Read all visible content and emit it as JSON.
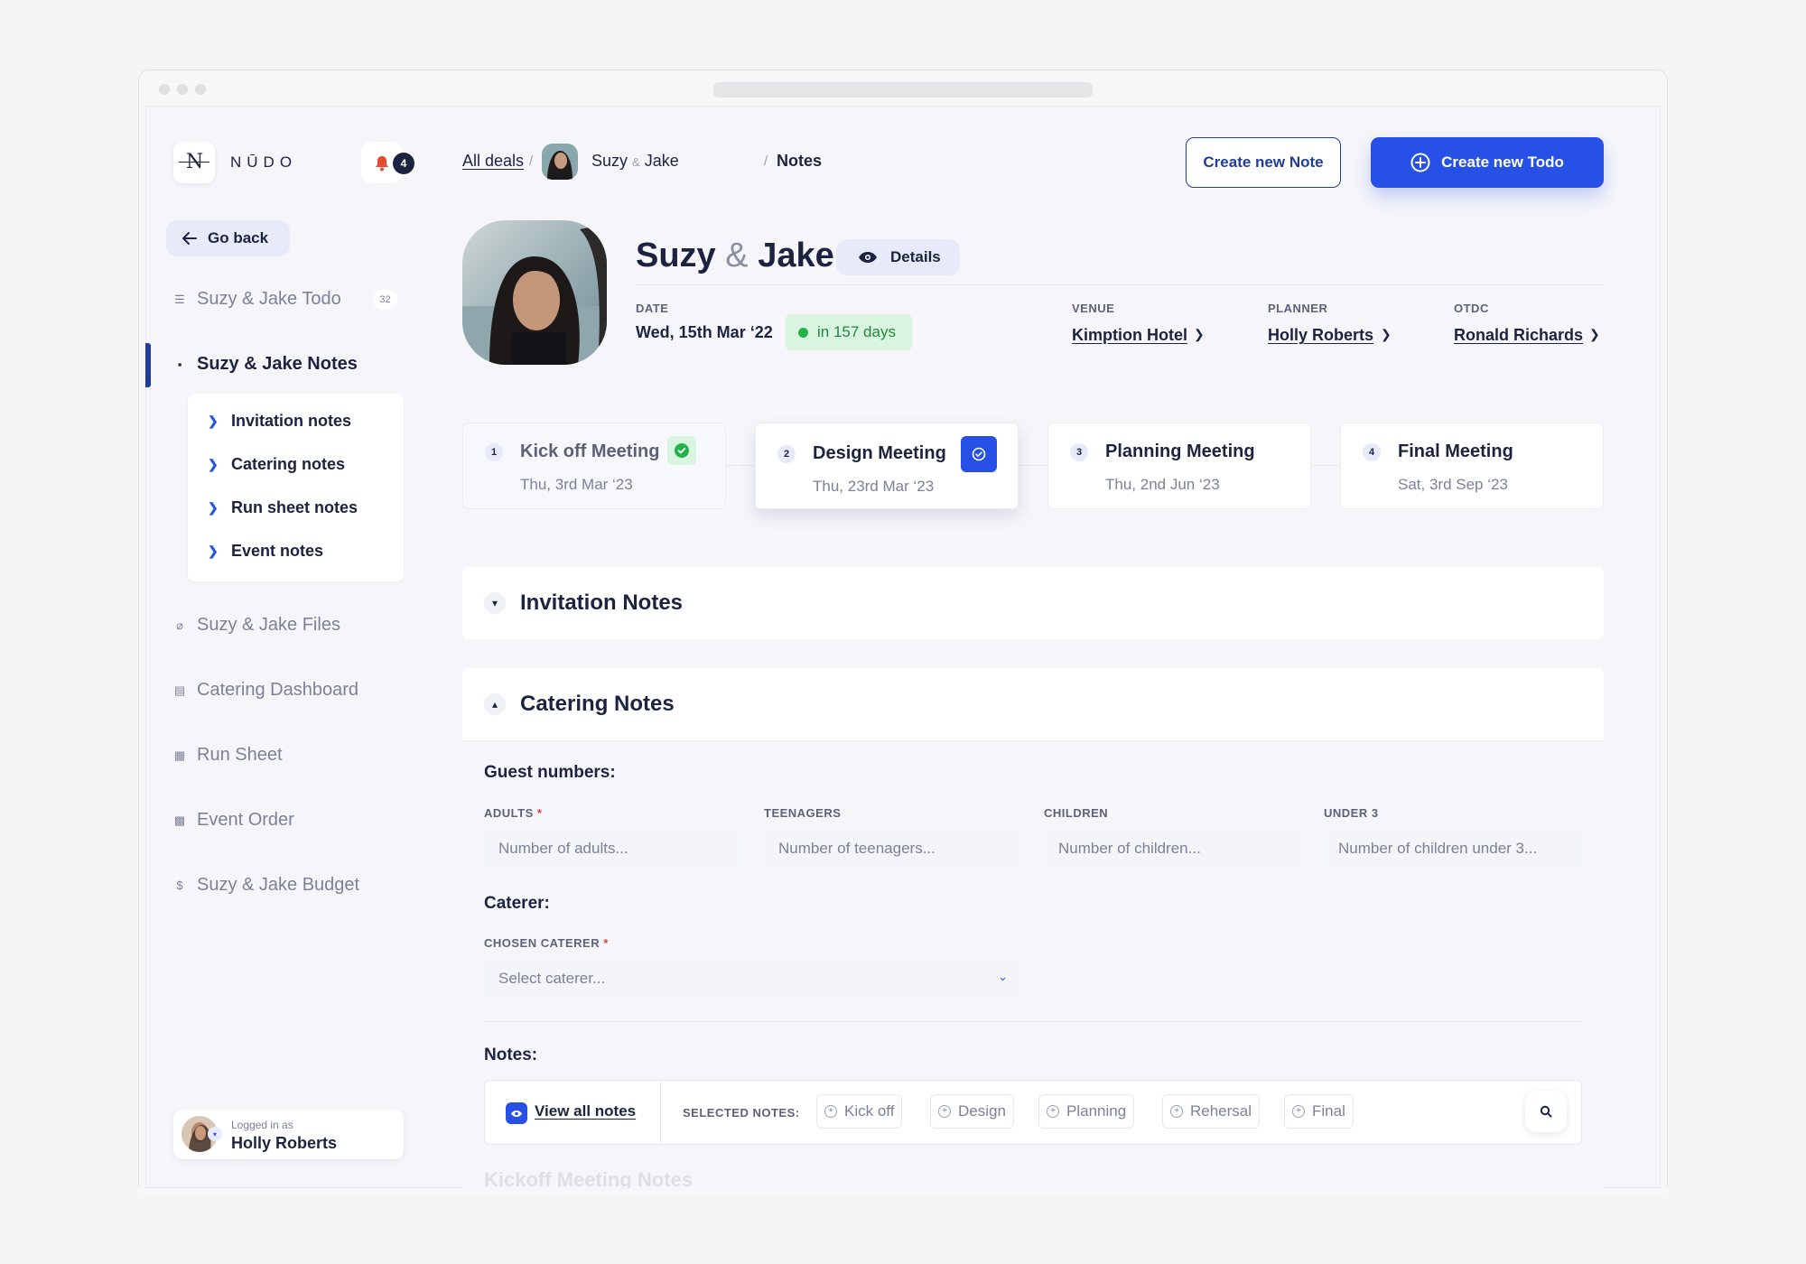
{
  "brand": {
    "logo_letter": "N",
    "name": "NŪDO"
  },
  "notifications": {
    "count": "4"
  },
  "sidebar": {
    "go_back": "Go back",
    "items": [
      {
        "label": "Suzy & Jake Todo",
        "count": "32"
      },
      {
        "label": "Suzy & Jake Notes"
      },
      {
        "label": "Suzy & Jake Files"
      },
      {
        "label": "Catering Dashboard"
      },
      {
        "label": "Run Sheet"
      },
      {
        "label": "Event Order"
      },
      {
        "label": "Suzy & Jake Budget"
      }
    ],
    "subitems": [
      "Invitation notes",
      "Catering notes",
      "Run sheet notes",
      "Event notes"
    ]
  },
  "user": {
    "logged_in_as": "Logged in as",
    "name": "Holly Roberts"
  },
  "breadcrumb": {
    "all_deals": "All deals",
    "sep": "/",
    "name_a": "Suzy",
    "amp": "&",
    "name_b": "Jake",
    "current": "Notes"
  },
  "header": {
    "create_note": "Create new Note",
    "create_todo": "Create new Todo"
  },
  "deal": {
    "name_a": "Suzy",
    "amp": "&",
    "name_b": "Jake",
    "details_label": "Details",
    "date_label": "DATE",
    "date": "Wed, 15th Mar ‘22",
    "countdown": "in 157 days",
    "venue_label": "VENUE",
    "venue": "Kimption Hotel",
    "planner_label": "PLANNER",
    "planner": "Holly Roberts",
    "otdc_label": "OTDC",
    "otdc": "Ronald Richards"
  },
  "meetings": [
    {
      "num": "1",
      "name": "Kick off Meeting",
      "date": "Thu, 3rd Mar ‘23",
      "status": "done"
    },
    {
      "num": "2",
      "name": "Design Meeting",
      "date": "Thu, 23rd Mar ‘23",
      "status": "current"
    },
    {
      "num": "3",
      "name": "Planning Meeting",
      "date": "Thu, 2nd Jun ‘23",
      "status": "upcoming"
    },
    {
      "num": "4",
      "name": "Final Meeting",
      "date": "Sat, 3rd Sep ‘23",
      "status": "upcoming"
    }
  ],
  "invitation": {
    "title": "Invitation Notes"
  },
  "catering": {
    "title": "Catering Notes",
    "guest_heading": "Guest numbers:",
    "fields": [
      {
        "label": "ADULTS",
        "required": "*",
        "placeholder": "Number of adults..."
      },
      {
        "label": "TEENAGERS",
        "placeholder": "Number of teenagers..."
      },
      {
        "label": "CHILDREN",
        "placeholder": "Number of children..."
      },
      {
        "label": "UNDER 3",
        "placeholder": "Number of children under 3..."
      }
    ],
    "caterer_heading": "Caterer:",
    "caterer_label": "CHOSEN CATERER",
    "caterer_required": "*",
    "caterer_placeholder": "Select caterer...",
    "notes_heading": "Notes:",
    "view_all": "View all notes",
    "selected_label": "SELECTED NOTES:",
    "tags": [
      "Kick off",
      "Design",
      "Planning",
      "Rehersal",
      "Final"
    ],
    "faded_heading": "Kickoff Meeting Notes"
  },
  "colors": {
    "primary": "#2751e6",
    "navy": "#1c2340",
    "success": "#23863f"
  }
}
